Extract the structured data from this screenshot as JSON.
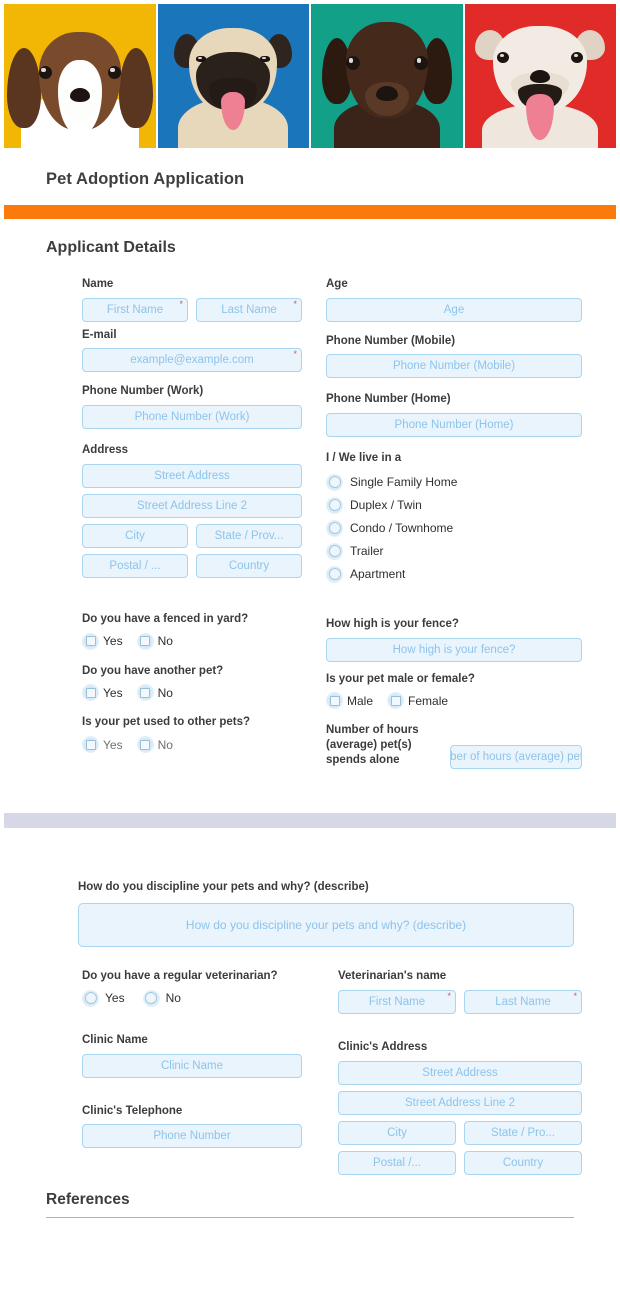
{
  "hero": {
    "alt": "four dog portraits banner",
    "tiles": [
      {
        "name": "beagle-puppy-photo",
        "bg": "#F2B705",
        "coat": "#6b4326",
        "accent": "#ffffff",
        "ear": "#4a2d1b"
      },
      {
        "name": "pug-photo",
        "bg": "#1B75BB",
        "coat": "#e4cfae",
        "accent": "#2a2020",
        "ear": "#3a2c22"
      },
      {
        "name": "chocolate-labrador-photo",
        "bg": "#13A089",
        "coat": "#3a2318",
        "accent": "#4a2f20",
        "ear": "#2a180f"
      },
      {
        "name": "bulldog-photo",
        "bg": "#E02B28",
        "coat": "#efe7dd",
        "accent": "#d9cec2",
        "ear": "#e3d5c7"
      }
    ]
  },
  "form": {
    "title": "Pet Adoption Application",
    "accent_color": "#FA7B0C",
    "separator_color": "#D6D9E5",
    "field_bg": "#E9F4FD",
    "field_border": "#A9D5F2",
    "placeholder_color": "#8DC4EA",
    "required_mark": "*",
    "required_color": "#E8514A"
  },
  "applicant": {
    "heading": "Applicant Details",
    "name": {
      "label": "Name",
      "first_placeholder": "First Name",
      "last_placeholder": "Last Name",
      "first_value": "",
      "last_value": ""
    },
    "age": {
      "label": "Age",
      "placeholder": "Age",
      "value": ""
    },
    "email": {
      "label": "E-mail",
      "placeholder": "example@example.com",
      "value": ""
    },
    "phone_mobile": {
      "label": "Phone Number (Mobile)",
      "placeholder": "Phone Number (Mobile)",
      "value": ""
    },
    "phone_work": {
      "label": "Phone Number (Work)",
      "placeholder": "Phone Number (Work)",
      "value": ""
    },
    "phone_home": {
      "label": "Phone Number (Home)",
      "placeholder": "Phone Number (Home)",
      "value": ""
    },
    "address": {
      "label": "Address",
      "street": "Street Address",
      "street2": "Street Address Line 2",
      "city": "City",
      "state": "State / Prov...",
      "postal": "Postal / ...",
      "country": "Country"
    },
    "residence": {
      "label": "I / We live in a",
      "options": [
        "Single Family Home",
        "Duplex / Twin",
        "Condo / Townhome",
        "Trailer",
        "Apartment"
      ],
      "selected": ""
    },
    "fenced_yard": {
      "label": "Do you have a fenced in yard?",
      "options": [
        "Yes",
        "No"
      ],
      "selected": ""
    },
    "fence_height": {
      "label": "How high is your fence?",
      "placeholder": "How high is your fence?",
      "value": ""
    },
    "another_pet": {
      "label": "Do you have another pet?",
      "options": [
        "Yes",
        "No"
      ],
      "selected": ""
    },
    "pet_gender": {
      "label": "Is your pet male or female?",
      "options": [
        "Male",
        "Female"
      ],
      "selected": ""
    },
    "used_to_other_pets": {
      "label": "Is your pet used to other pets?",
      "options": [
        "Yes",
        "No"
      ],
      "selected": ""
    },
    "hours_alone": {
      "label": "Number of hours (average) pet(s) spends alone",
      "placeholder": "Number of hours (average) pet(s)...",
      "value": ""
    }
  },
  "page_two": {
    "discipline": {
      "label": "How do you discipline your pets and why? (describe)",
      "placeholder": "How do you discipline your pets and why? (describe)",
      "value": ""
    },
    "regular_vet": {
      "label": "Do you have a regular veterinarian?",
      "options": [
        "Yes",
        "No"
      ],
      "selected": ""
    },
    "vet_name": {
      "label": "Veterinarian's name",
      "first_placeholder": "First Name",
      "last_placeholder": "Last Name",
      "first_value": "",
      "last_value": ""
    },
    "clinic_name": {
      "label": "Clinic Name",
      "placeholder": "Clinic Name",
      "value": ""
    },
    "clinic_address": {
      "label": "Clinic's Address",
      "street": "Street Address",
      "street2": "Street Address Line 2",
      "city": "City",
      "state": "State / Pro...",
      "postal": "Postal /...",
      "country": "Country"
    },
    "clinic_phone": {
      "label": "Clinic's Telephone",
      "placeholder": "Phone Number",
      "value": ""
    },
    "references": {
      "heading": "References",
      "rule_color": "#E0A764"
    }
  }
}
